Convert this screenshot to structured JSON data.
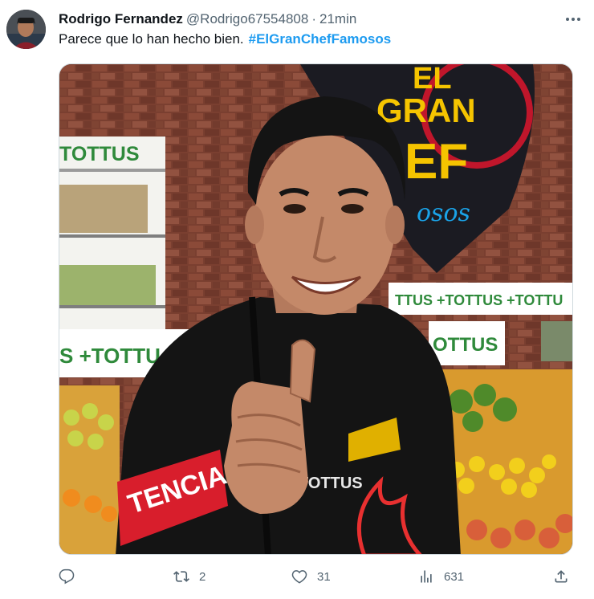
{
  "tweet": {
    "author_name": "Rodrigo Fernandez",
    "author_handle": "@Rodrigo67554808",
    "separator": "·",
    "time": "21min",
    "text": "Parece que lo han hecho bien.",
    "hashtag": "#ElGranChefFamosos",
    "media": {
      "sign_logo": "EL GRAN CHEF",
      "sign_logo_small": "famosos",
      "store_brand": "TOTTUS",
      "banner_text": "+TOTTUS +TOTTUS +TOTTU",
      "left_sign": "TOTTUS",
      "left_banner": "S +TOTTU",
      "right_sign": "OTTUS",
      "apron_text": "TOTTUS",
      "armband_text": "TENCIA"
    },
    "actions": {
      "reply_icon": "reply-icon",
      "retweet_icon": "retweet-icon",
      "retweets": "2",
      "like_icon": "heart-icon",
      "likes": "31",
      "views_icon": "views-icon",
      "views": "631",
      "share_icon": "share-icon"
    }
  },
  "colors": {
    "hashtag": "#1d9bf0",
    "secondary_text": "#536471",
    "primary_text": "#0f1419",
    "border": "#cfd9de"
  }
}
